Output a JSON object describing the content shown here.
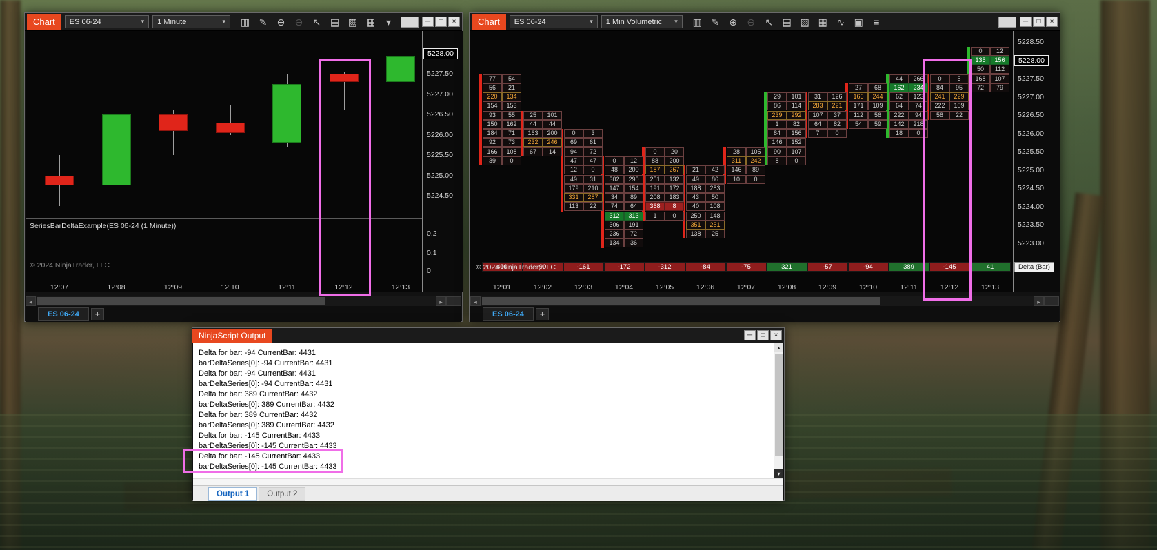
{
  "left_window": {
    "badge": "Chart",
    "instrument": "ES 06-24",
    "interval": "1 Minute",
    "toolbar": [
      {
        "name": "chart-style-icon",
        "glyph": "▥"
      },
      {
        "name": "draw-icon",
        "glyph": "✎"
      },
      {
        "name": "zoom-in-icon",
        "glyph": "⊕"
      },
      {
        "name": "zoom-out-icon",
        "glyph": "⊖",
        "dim": true
      },
      {
        "name": "cursor-icon",
        "glyph": "↖"
      },
      {
        "name": "data-box-icon",
        "glyph": "▤"
      },
      {
        "name": "chart-trader-icon",
        "glyph": "▧"
      },
      {
        "name": "indicator-panel-icon",
        "glyph": "▦"
      },
      {
        "name": "toolbar-dropdown-icon",
        "glyph": "▾"
      }
    ],
    "window_buttons": [
      {
        "name": "minimize-button",
        "glyph": "─"
      },
      {
        "name": "maximize-button",
        "glyph": "□"
      },
      {
        "name": "close-button",
        "glyph": "×"
      }
    ],
    "scroll_left": "◂",
    "scroll_right": "▸",
    "tab": "ES 06-24",
    "add_tab": "+"
  },
  "right_window": {
    "badge": "Chart",
    "instrument": "ES 06-24",
    "interval": "1 Min Volumetric",
    "toolbar": [
      {
        "name": "chart-style-icon",
        "glyph": "▥"
      },
      {
        "name": "draw-icon",
        "glyph": "✎"
      },
      {
        "name": "zoom-in-icon",
        "glyph": "⊕"
      },
      {
        "name": "zoom-out-icon",
        "glyph": "⊖",
        "dim": true
      },
      {
        "name": "cursor-icon",
        "glyph": "↖"
      },
      {
        "name": "data-box-icon",
        "glyph": "▤"
      },
      {
        "name": "chart-trader-icon",
        "glyph": "▧"
      },
      {
        "name": "indicator-panel-icon",
        "glyph": "▦"
      },
      {
        "name": "zigzag-icon",
        "glyph": "∿"
      },
      {
        "name": "snap-mode-icon",
        "glyph": "▣"
      },
      {
        "name": "list-icon",
        "glyph": "≡"
      }
    ],
    "window_buttons": [
      {
        "name": "minimize-button",
        "glyph": "─"
      },
      {
        "name": "maximize-button",
        "glyph": "□"
      },
      {
        "name": "close-button",
        "glyph": "×"
      }
    ],
    "scroll_left": "◂",
    "scroll_right": "▸",
    "tab": "ES 06-24",
    "add_tab": "+"
  },
  "output_window": {
    "title": "NinjaScript Output",
    "lines": [
      "Delta for bar: -94 CurrentBar: 4431",
      "barDeltaSeries[0]: -94 CurrentBar: 4431",
      "Delta for bar: -94 CurrentBar: 4431",
      "barDeltaSeries[0]: -94 CurrentBar: 4431",
      "Delta for bar: 389 CurrentBar: 4432",
      "barDeltaSeries[0]: 389 CurrentBar: 4432",
      "Delta for bar: 389 CurrentBar: 4432",
      "barDeltaSeries[0]: 389 CurrentBar: 4432",
      "Delta for bar: -145 CurrentBar: 4433",
      "barDeltaSeries[0]: -145 CurrentBar: 4433",
      "Delta for bar: -145 CurrentBar: 4433",
      "barDeltaSeries[0]: -145 CurrentBar: 4433"
    ],
    "highlighted_line_start": 10,
    "tabs": [
      {
        "label": "Output 1",
        "active": true
      },
      {
        "label": "Output 2",
        "active": false
      }
    ],
    "scroll_up": "▴",
    "scroll_down": "▾",
    "window_buttons": [
      {
        "name": "minimize-button",
        "glyph": "─"
      },
      {
        "name": "maximize-button",
        "glyph": "□"
      },
      {
        "name": "close-button",
        "glyph": "×"
      }
    ]
  },
  "chart_data": [
    {
      "type": "candlestick",
      "title": "ES 06-24 (1 Minute)",
      "x_labels": [
        "12:07",
        "12:08",
        "12:09",
        "12:10",
        "12:11",
        "12:12",
        "12:13"
      ],
      "y_ticks": [
        "5228.00",
        "5227.50",
        "5227.00",
        "5226.50",
        "5226.00",
        "5225.50",
        "5225.00",
        "5224.50"
      ],
      "ylim": [
        5224.1,
        5228.45
      ],
      "last_price": "5228.00",
      "highlight_time": "12:12",
      "candles": [
        {
          "t": "12:07",
          "o": 5225.0,
          "h": 5225.5,
          "l": 5224.25,
          "c": 5224.75,
          "dir": "down"
        },
        {
          "t": "12:08",
          "o": 5224.75,
          "h": 5226.75,
          "l": 5224.6,
          "c": 5226.5,
          "dir": "up"
        },
        {
          "t": "12:09",
          "o": 5226.5,
          "h": 5226.6,
          "l": 5225.5,
          "c": 5226.1,
          "dir": "down"
        },
        {
          "t": "12:10",
          "o": 5226.3,
          "h": 5226.75,
          "l": 5226.0,
          "c": 5226.05,
          "dir": "down"
        },
        {
          "t": "12:11",
          "o": 5225.8,
          "h": 5227.5,
          "l": 5225.7,
          "c": 5227.25,
          "dir": "up"
        },
        {
          "t": "12:12",
          "o": 5227.5,
          "h": 5227.55,
          "l": 5226.6,
          "c": 5227.3,
          "dir": "down"
        },
        {
          "t": "12:13",
          "o": 5227.3,
          "h": 5228.25,
          "l": 5227.25,
          "c": 5227.95,
          "dir": "up"
        }
      ],
      "indicator_panel": {
        "label": "SeriesBarDeltaExample(ES 06-24 (1 Minute))",
        "y_ticks": [
          "0.2",
          "0.1",
          "0"
        ]
      },
      "copyright": "© 2024 NinjaTrader, LLC"
    },
    {
      "type": "footprint",
      "title": "ES 06-24 (1 Min Volumetric)",
      "x_labels": [
        "12:01",
        "12:02",
        "12:03",
        "12:04",
        "12:05",
        "12:06",
        "12:07",
        "12:08",
        "12:09",
        "12:10",
        "12:11",
        "12:12",
        "12:13"
      ],
      "y_ticks": [
        "5228.50",
        "5228.00",
        "5227.50",
        "5227.00",
        "5226.50",
        "5226.00",
        "5225.50",
        "5225.00",
        "5224.50",
        "5224.00",
        "5223.50",
        "5223.00"
      ],
      "last_price": "5228.00",
      "delta_label": "Delta (Bar)",
      "highlight_time": "12:12",
      "deltas": [
        {
          "t": "12:01",
          "v": "400",
          "sign": "neg"
        },
        {
          "t": "12:02",
          "v": "90",
          "sign": "neg"
        },
        {
          "t": "12:03",
          "v": "-161",
          "sign": "neg"
        },
        {
          "t": "12:04",
          "v": "-172",
          "sign": "neg"
        },
        {
          "t": "12:05",
          "v": "-312",
          "sign": "neg"
        },
        {
          "t": "12:06",
          "v": "-84",
          "sign": "neg"
        },
        {
          "t": "12:07",
          "v": "-75",
          "sign": "neg"
        },
        {
          "t": "12:08",
          "v": "321",
          "sign": "pos"
        },
        {
          "t": "12:09",
          "v": "-57",
          "sign": "neg"
        },
        {
          "t": "12:10",
          "v": "-94",
          "sign": "neg"
        },
        {
          "t": "12:11",
          "v": "389",
          "sign": "pos"
        },
        {
          "t": "12:12",
          "v": "-145",
          "sign": "neg"
        },
        {
          "t": "12:13",
          "v": "41",
          "sign": "pos"
        }
      ],
      "bars": [
        {
          "t": "12:01",
          "top": 5227.5,
          "dir": "down",
          "cells": [
            [
              "77",
              "54"
            ],
            [
              "56",
              "21"
            ],
            [
              "220",
              "134",
              "poc"
            ],
            [
              "154",
              "153"
            ],
            [
              "93",
              "55"
            ],
            [
              "150",
              "162"
            ],
            [
              "184",
              "71"
            ],
            [
              "92",
              "73"
            ],
            [
              "166",
              "108"
            ],
            [
              "39",
              "0"
            ]
          ]
        },
        {
          "t": "12:02",
          "top": 5226.5,
          "dir": "down",
          "cells": [
            [
              "25",
              "101"
            ],
            [
              "44",
              "44"
            ],
            [
              "163",
              "200"
            ],
            [
              "232",
              "246",
              "poc"
            ],
            [
              "67",
              "14"
            ]
          ]
        },
        {
          "t": "12:03",
          "top": 5226.0,
          "dir": "down",
          "cells": [
            [
              "0",
              "3"
            ],
            [
              "69",
              "61"
            ],
            [
              "94",
              "72"
            ],
            [
              "47",
              "47"
            ],
            [
              "12",
              "0"
            ],
            [
              "49",
              "31"
            ],
            [
              "179",
              "210"
            ],
            [
              "331",
              "287",
              "poc"
            ],
            [
              "113",
              "22"
            ]
          ]
        },
        {
          "t": "12:04",
          "top": 5225.25,
          "dir": "down",
          "cells": [
            [
              "0",
              "12"
            ],
            [
              "48",
              "200"
            ],
            [
              "302",
              "290"
            ],
            [
              "147",
              "154"
            ],
            [
              "34",
              "89"
            ],
            [
              "74",
              "64"
            ],
            [
              "312",
              "313",
              "maxup"
            ],
            [
              "306",
              "191"
            ],
            [
              "236",
              "72"
            ],
            [
              "134",
              "36"
            ]
          ]
        },
        {
          "t": "12:05",
          "top": 5225.5,
          "dir": "down",
          "cells": [
            [
              "0",
              "20"
            ],
            [
              "88",
              "200"
            ],
            [
              "187",
              "267",
              "poc"
            ],
            [
              "251",
              "132"
            ],
            [
              "191",
              "172"
            ],
            [
              "208",
              "183"
            ],
            [
              "368",
              "8",
              "maxdown"
            ],
            [
              "1",
              "0"
            ]
          ]
        },
        {
          "t": "12:06",
          "top": 5225.0,
          "dir": "down",
          "cells": [
            [
              "21",
              "42"
            ],
            [
              "49",
              "86"
            ],
            [
              "188",
              "283"
            ],
            [
              "43",
              "50"
            ],
            [
              "40",
              "108"
            ],
            [
              "250",
              "148"
            ],
            [
              "351",
              "251",
              "poc"
            ],
            [
              "138",
              "25"
            ]
          ]
        },
        {
          "t": "12:07",
          "top": 5225.5,
          "dir": "down",
          "cells": [
            [
              "28",
              "105"
            ],
            [
              "311",
              "242",
              "poc"
            ],
            [
              "146",
              "89"
            ],
            [
              "10",
              "0"
            ]
          ]
        },
        {
          "t": "12:08",
          "top": 5227.0,
          "dir": "up",
          "cells": [
            [
              "29",
              "101"
            ],
            [
              "86",
              "114"
            ],
            [
              "239",
              "292",
              "poc"
            ],
            [
              "1",
              "82"
            ],
            [
              "84",
              "156"
            ],
            [
              "146",
              "152"
            ],
            [
              "90",
              "107"
            ],
            [
              "8",
              "0"
            ]
          ]
        },
        {
          "t": "12:09",
          "top": 5227.0,
          "dir": "down",
          "cells": [
            [
              "31",
              "126"
            ],
            [
              "283",
              "221",
              "poc"
            ],
            [
              "107",
              "37"
            ],
            [
              "64",
              "82"
            ],
            [
              "7",
              "0"
            ]
          ]
        },
        {
          "t": "12:10",
          "top": 5227.25,
          "dir": "down",
          "cells": [
            [
              "27",
              "68"
            ],
            [
              "166",
              "244",
              "poc"
            ],
            [
              "171",
              "109"
            ],
            [
              "112",
              "56"
            ],
            [
              "54",
              "59"
            ]
          ]
        },
        {
          "t": "12:11",
          "top": 5227.5,
          "dir": "up",
          "cells": [
            [
              "44",
              "266"
            ],
            [
              "162",
              "234",
              "maxup"
            ],
            [
              "62",
              "123"
            ],
            [
              "64",
              "74"
            ],
            [
              "222",
              "94"
            ],
            [
              "142",
              "218"
            ],
            [
              "18",
              "0"
            ]
          ]
        },
        {
          "t": "12:12",
          "top": 5227.5,
          "dir": "down",
          "cells": [
            [
              "0",
              "5"
            ],
            [
              "84",
              "95"
            ],
            [
              "241",
              "229",
              "poc"
            ],
            [
              "222",
              "109"
            ],
            [
              "58",
              "22"
            ]
          ]
        },
        {
          "t": "12:13",
          "top": 5228.25,
          "dir": "up",
          "cells": [
            [
              "0",
              "12"
            ],
            [
              "135",
              "156",
              "maxup"
            ],
            [
              "50",
              "112"
            ],
            [
              "168",
              "107"
            ],
            [
              "72",
              "79"
            ]
          ]
        }
      ],
      "copyright": "© 2024 NinjaTrader, LLC"
    }
  ]
}
